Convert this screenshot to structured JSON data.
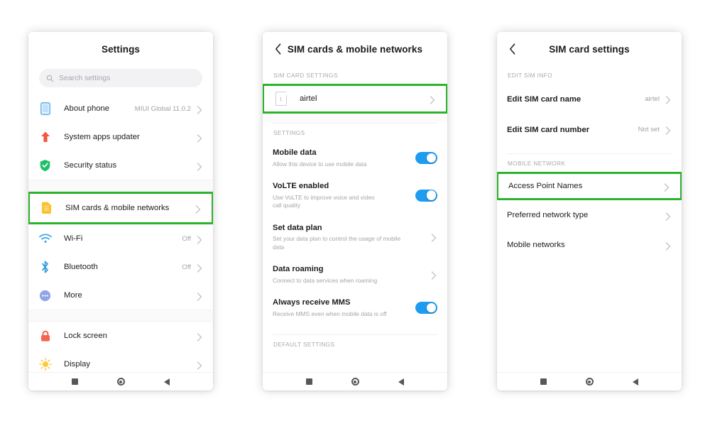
{
  "theme": {
    "highlight_green": "#2bb32b",
    "toggle_blue": "#1e9cf0",
    "page_background": "#ffffff"
  },
  "phone1": {
    "title": "Settings",
    "search": {
      "placeholder": "Search settings",
      "icon": "search-icon"
    },
    "items": [
      {
        "label": "About phone",
        "value": "MIUI Global 11.0.2",
        "icon": "phone-icon",
        "highlight": false
      },
      {
        "label": "System apps updater",
        "value": "",
        "icon": "up-arrow-icon",
        "highlight": false
      },
      {
        "label": "Security status",
        "value": "",
        "icon": "shield-check-icon",
        "highlight": false
      },
      {
        "label": "SIM cards & mobile networks",
        "value": "",
        "icon": "sim-card-icon",
        "highlight": true
      },
      {
        "label": "Wi-Fi",
        "value": "Off",
        "icon": "wifi-icon",
        "highlight": false
      },
      {
        "label": "Bluetooth",
        "value": "Off",
        "icon": "bluetooth-icon",
        "highlight": false
      },
      {
        "label": "More",
        "value": "",
        "icon": "more-icon",
        "highlight": false
      },
      {
        "label": "Lock screen",
        "value": "",
        "icon": "lock-icon",
        "highlight": false
      },
      {
        "label": "Display",
        "value": "",
        "icon": "brightness-icon",
        "highlight": false
      }
    ]
  },
  "phone2": {
    "title": "SIM cards & mobile networks",
    "back_icon": "back-chevron-icon",
    "section_sim": "SIM CARD SETTINGS",
    "sim_row": {
      "label": "airtel",
      "slot": "1",
      "icon": "sim-chip-icon",
      "highlight": true
    },
    "section_settings": "SETTINGS",
    "settings_rows": [
      {
        "title": "Mobile data",
        "subtitle": "Allow this device to use mobile data",
        "control": "toggle",
        "on": true
      },
      {
        "title": "VoLTE enabled",
        "subtitle": "Use VoLTE to improve voice and video call quality",
        "control": "toggle",
        "on": true
      },
      {
        "title": "Set data plan",
        "subtitle": "Set your data plan to control the usage of mobile data",
        "control": "chevron",
        "on": false
      },
      {
        "title": "Data roaming",
        "subtitle": "Connect to data services when roaming",
        "control": "chevron",
        "on": false
      },
      {
        "title": "Always receive MMS",
        "subtitle": "Receive MMS even when mobile data is off",
        "control": "toggle",
        "on": true
      }
    ],
    "section_default": "DEFAULT SETTINGS"
  },
  "phone3": {
    "title": "SIM card settings",
    "back_icon": "back-chevron-icon",
    "section_edit": "EDIT SIM INFO",
    "edit_rows": [
      {
        "label": "Edit SIM card name",
        "value": "airtel"
      },
      {
        "label": "Edit SIM card number",
        "value": "Not set"
      }
    ],
    "section_network": "MOBILE NETWORK",
    "network_rows": [
      {
        "label": "Access Point Names",
        "highlight": true
      },
      {
        "label": "Preferred network type",
        "highlight": false
      },
      {
        "label": "Mobile networks",
        "highlight": false
      }
    ]
  },
  "navbar": {
    "recents": "recents-square-icon",
    "home": "home-circle-icon",
    "back": "back-triangle-icon"
  }
}
